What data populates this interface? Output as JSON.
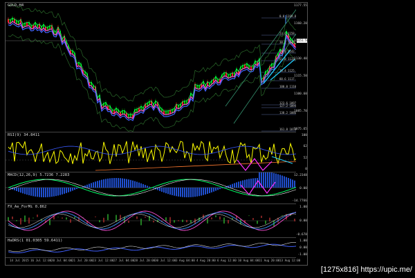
{
  "panes": [
    {
      "id": "main",
      "label": "GOLD,H4",
      "ticks": [
        "1177.55",
        "1160.20",
        "1145.30",
        "1130.40",
        "1115.50",
        "1100.60",
        "1085.70",
        "1075.65"
      ]
    },
    {
      "id": "rsi",
      "label": "RSI(9) 34.8411",
      "ticks": [
        "100",
        "62",
        "52",
        "0"
      ]
    },
    {
      "id": "macd",
      "label": "MACD(12,26,9) 5.7236 7.2283",
      "ticks": [
        "12.2348",
        "0.00",
        "-14.7766"
      ]
    },
    {
      "id": "fx",
      "label": "FX_Ae_ForMi 0.862",
      "ticks": [
        "1.00",
        "0.00",
        "-0.678"
      ]
    },
    {
      "id": "hadrs",
      "label": "HaDRS(1 01.0305 59.6411)",
      "ticks": [
        "1.00",
        "0.00",
        "-1.00"
      ]
    }
  ],
  "fibo_levels": [
    {
      "label": "0.0 1169.80"
    },
    {
      "label": "23.6 1158.60"
    },
    {
      "label": "38.2 1147.90"
    },
    {
      "label": "50.0 1142.10"
    },
    {
      "label": "61.8 1133.60"
    },
    {
      "label": "76.4 1125.40"
    },
    {
      "label": "88.6 1117.90"
    },
    {
      "label": "100.0 1110.50"
    },
    {
      "label": "123.6 1097.80"
    },
    {
      "label": "127.2 1094.10"
    },
    {
      "label": "138.2 1086.90"
    },
    {
      "label": "161.8 1073.60"
    }
  ],
  "current_price": "1151.50",
  "x_labels": [
    "14 Jul 2015",
    "16 Jul 12:00",
    "20 Jul 04:00",
    "21 Jul 20:00",
    "23 Jul 12:00",
    "27 Jul 04:00",
    "28 Jul 20:00",
    "30 Jul 12:00",
    "3 Aug 04:00",
    "4 Aug 20:00",
    "6 Aug 12:00",
    "10 Aug 04:00",
    "11 Aug 20:00",
    "13 Aug 12:00"
  ],
  "watermark": "[1275x816] https://upic.me/",
  "colors": {
    "bull": "#00c000",
    "bear": "#ff2020",
    "ma_pink": "#ff4fd8",
    "ma_blue": "#4060ff",
    "ma_green": "#00ff66",
    "rsi": "#ffff00",
    "arrow_orange": "#ff7a30",
    "arrow_cyan": "#20d0ff",
    "arrow_magenta": "#ff30ff",
    "macd_hist": "#2050d0"
  }
}
